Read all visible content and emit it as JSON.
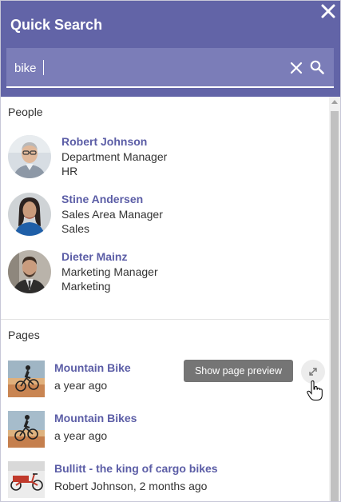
{
  "header": {
    "title": "Quick Search",
    "close_icon": "close-icon"
  },
  "search": {
    "value": "bike",
    "clear_icon": "clear-icon",
    "search_icon": "search-icon"
  },
  "people": {
    "heading": "People",
    "items": [
      {
        "name": "Robert Johnson",
        "role": "Department Manager",
        "department": "HR"
      },
      {
        "name": "Stine Andersen",
        "role": "Sales Area Manager",
        "department": "Sales"
      },
      {
        "name": "Dieter Mainz",
        "role": "Marketing Manager",
        "department": "Marketing"
      }
    ]
  },
  "pages": {
    "heading": "Pages",
    "items": [
      {
        "title": "Mountain Bike",
        "meta": "a year ago"
      },
      {
        "title": "Mountain Bikes",
        "meta": "a year ago"
      },
      {
        "title": "Bullitt - the king of cargo bikes",
        "meta": "Robert Johnson, 2 months ago"
      }
    ],
    "preview_button": "Show page preview",
    "expand_icon": "expand-icon"
  },
  "colors": {
    "brand": "#6264a7",
    "search_bg": "#7b7db8",
    "link": "#5b5da6",
    "tooltip_bg": "#757575"
  }
}
